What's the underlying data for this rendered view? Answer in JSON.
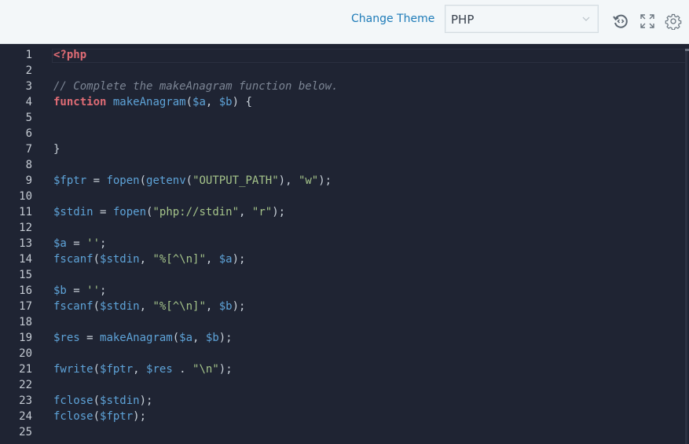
{
  "toolbar": {
    "change_theme_label": "Change Theme",
    "language_selected": "PHP",
    "icons": [
      "restore-code-icon",
      "fullscreen-icon",
      "settings-gear-icon"
    ]
  },
  "editor": {
    "colors": {
      "background": "#1f2433",
      "keyword": "#e06c75",
      "identifier": "#5ea3d8",
      "string": "#a5c48a",
      "comment": "#7c8594"
    },
    "lines": [
      {
        "n": "1",
        "tokens": [
          {
            "t": "kw",
            "v": "<?php"
          }
        ]
      },
      {
        "n": "2",
        "tokens": []
      },
      {
        "n": "3",
        "tokens": [
          {
            "t": "cm",
            "v": "// Complete the makeAnagram function below."
          }
        ]
      },
      {
        "n": "4",
        "tokens": [
          {
            "t": "kw",
            "v": "function"
          },
          {
            "t": "pn",
            "v": " "
          },
          {
            "t": "fn",
            "v": "makeAnagram"
          },
          {
            "t": "pn",
            "v": "("
          },
          {
            "t": "var",
            "v": "$a"
          },
          {
            "t": "pn",
            "v": ", "
          },
          {
            "t": "var",
            "v": "$b"
          },
          {
            "t": "pn",
            "v": ") {"
          }
        ]
      },
      {
        "n": "5",
        "tokens": []
      },
      {
        "n": "6",
        "tokens": []
      },
      {
        "n": "7",
        "tokens": [
          {
            "t": "pn",
            "v": "}"
          }
        ]
      },
      {
        "n": "8",
        "tokens": []
      },
      {
        "n": "9",
        "tokens": [
          {
            "t": "var",
            "v": "$fptr"
          },
          {
            "t": "pn",
            "v": " = "
          },
          {
            "t": "fn",
            "v": "fopen"
          },
          {
            "t": "pn",
            "v": "("
          },
          {
            "t": "fn",
            "v": "getenv"
          },
          {
            "t": "pn",
            "v": "("
          },
          {
            "t": "str",
            "v": "\"OUTPUT_PATH\""
          },
          {
            "t": "pn",
            "v": "), "
          },
          {
            "t": "str",
            "v": "\"w\""
          },
          {
            "t": "pn",
            "v": ");"
          }
        ]
      },
      {
        "n": "10",
        "tokens": []
      },
      {
        "n": "11",
        "tokens": [
          {
            "t": "var",
            "v": "$stdin"
          },
          {
            "t": "pn",
            "v": " = "
          },
          {
            "t": "fn",
            "v": "fopen"
          },
          {
            "t": "pn",
            "v": "("
          },
          {
            "t": "str",
            "v": "\"php://stdin\""
          },
          {
            "t": "pn",
            "v": ", "
          },
          {
            "t": "str",
            "v": "\"r\""
          },
          {
            "t": "pn",
            "v": ");"
          }
        ]
      },
      {
        "n": "12",
        "tokens": []
      },
      {
        "n": "13",
        "tokens": [
          {
            "t": "var",
            "v": "$a"
          },
          {
            "t": "pn",
            "v": " = "
          },
          {
            "t": "str",
            "v": "''"
          },
          {
            "t": "pn",
            "v": ";"
          }
        ]
      },
      {
        "n": "14",
        "tokens": [
          {
            "t": "fn",
            "v": "fscanf"
          },
          {
            "t": "pn",
            "v": "("
          },
          {
            "t": "var",
            "v": "$stdin"
          },
          {
            "t": "pn",
            "v": ", "
          },
          {
            "t": "str",
            "v": "\"%[^\\n]\""
          },
          {
            "t": "pn",
            "v": ", "
          },
          {
            "t": "var",
            "v": "$a"
          },
          {
            "t": "pn",
            "v": ");"
          }
        ]
      },
      {
        "n": "15",
        "tokens": []
      },
      {
        "n": "16",
        "tokens": [
          {
            "t": "var",
            "v": "$b"
          },
          {
            "t": "pn",
            "v": " = "
          },
          {
            "t": "str",
            "v": "''"
          },
          {
            "t": "pn",
            "v": ";"
          }
        ]
      },
      {
        "n": "17",
        "tokens": [
          {
            "t": "fn",
            "v": "fscanf"
          },
          {
            "t": "pn",
            "v": "("
          },
          {
            "t": "var",
            "v": "$stdin"
          },
          {
            "t": "pn",
            "v": ", "
          },
          {
            "t": "str",
            "v": "\"%[^\\n]\""
          },
          {
            "t": "pn",
            "v": ", "
          },
          {
            "t": "var",
            "v": "$b"
          },
          {
            "t": "pn",
            "v": ");"
          }
        ]
      },
      {
        "n": "18",
        "tokens": []
      },
      {
        "n": "19",
        "tokens": [
          {
            "t": "var",
            "v": "$res"
          },
          {
            "t": "pn",
            "v": " = "
          },
          {
            "t": "fn",
            "v": "makeAnagram"
          },
          {
            "t": "pn",
            "v": "("
          },
          {
            "t": "var",
            "v": "$a"
          },
          {
            "t": "pn",
            "v": ", "
          },
          {
            "t": "var",
            "v": "$b"
          },
          {
            "t": "pn",
            "v": ");"
          }
        ]
      },
      {
        "n": "20",
        "tokens": []
      },
      {
        "n": "21",
        "tokens": [
          {
            "t": "fn",
            "v": "fwrite"
          },
          {
            "t": "pn",
            "v": "("
          },
          {
            "t": "var",
            "v": "$fptr"
          },
          {
            "t": "pn",
            "v": ", "
          },
          {
            "t": "var",
            "v": "$res"
          },
          {
            "t": "pn",
            "v": " . "
          },
          {
            "t": "str",
            "v": "\"\\n\""
          },
          {
            "t": "pn",
            "v": ");"
          }
        ]
      },
      {
        "n": "22",
        "tokens": []
      },
      {
        "n": "23",
        "tokens": [
          {
            "t": "fn",
            "v": "fclose"
          },
          {
            "t": "pn",
            "v": "("
          },
          {
            "t": "var",
            "v": "$stdin"
          },
          {
            "t": "pn",
            "v": ");"
          }
        ]
      },
      {
        "n": "24",
        "tokens": [
          {
            "t": "fn",
            "v": "fclose"
          },
          {
            "t": "pn",
            "v": "("
          },
          {
            "t": "var",
            "v": "$fptr"
          },
          {
            "t": "pn",
            "v": ");"
          }
        ]
      },
      {
        "n": "25",
        "tokens": []
      }
    ]
  }
}
